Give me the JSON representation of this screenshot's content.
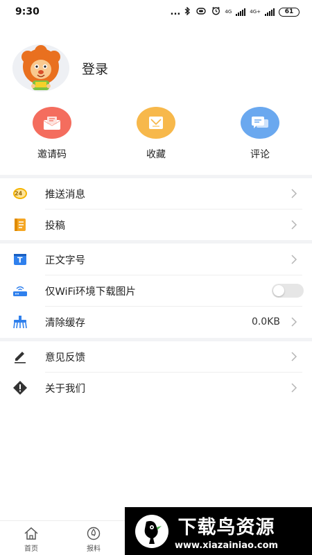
{
  "status_bar": {
    "time": "9:30",
    "dots": "...",
    "net1": "4G",
    "net2": "4G+",
    "battery": "61"
  },
  "profile": {
    "login_label": "登录",
    "avatar_icon": "cartoon-lion-avatar"
  },
  "quick_actions": [
    {
      "label": "邀请码",
      "icon": "envelope-icon",
      "color": "#f46d5e"
    },
    {
      "label": "收藏",
      "icon": "bookmark-tray-icon",
      "color": "#f7b84b"
    },
    {
      "label": "评论",
      "icon": "comment-bubbles-icon",
      "color": "#6aa8ef"
    }
  ],
  "menu": {
    "push": {
      "label": "推送消息",
      "icon_text": "24"
    },
    "submit": {
      "label": "投稿"
    },
    "font_size": {
      "label": "正文字号",
      "icon_text": "T"
    },
    "wifi_images": {
      "label": "仅WiFi环境下载图片",
      "enabled": false
    },
    "clear_cache": {
      "label": "清除缓存",
      "value": "0.0KB"
    },
    "feedback": {
      "label": "意见反馈"
    },
    "about": {
      "label": "关于我们"
    }
  },
  "tabbar": {
    "home": "首页",
    "report": "报料"
  },
  "watermark": {
    "title": "下载鸟资源",
    "url": "www.xiazainiao.com"
  },
  "colors": {
    "accent_blue": "#2f80ed",
    "accent_orange": "#f5a623",
    "separator": "#f2f3f5"
  }
}
